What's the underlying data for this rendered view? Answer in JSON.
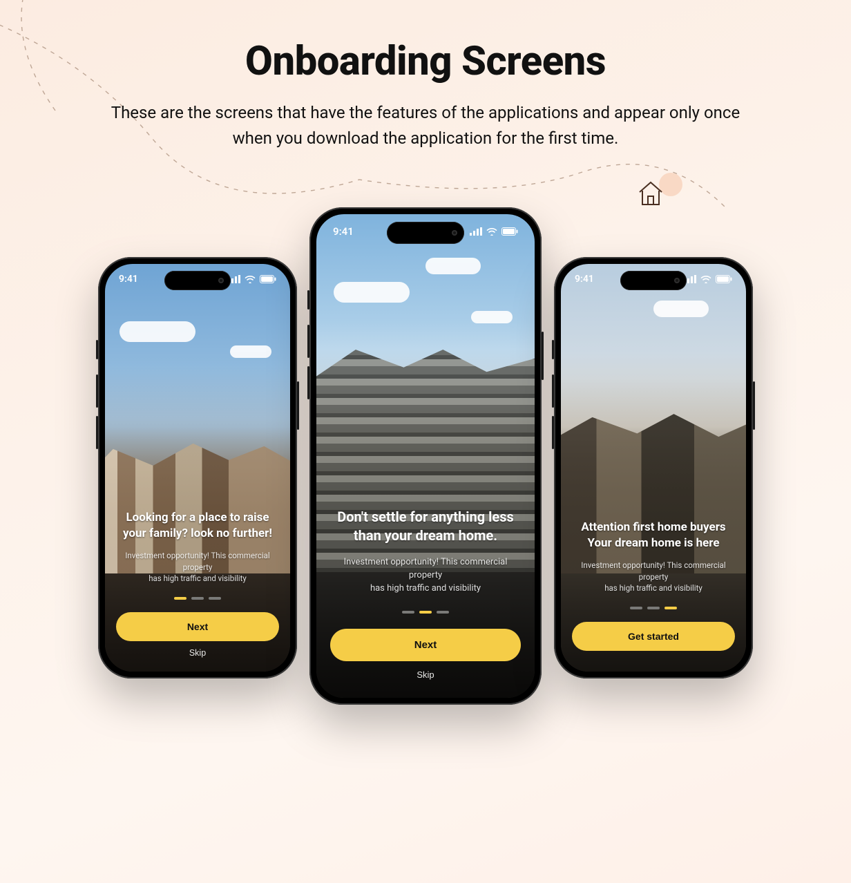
{
  "header": {
    "title": "Onboarding Screens",
    "subtitle": "These are the screens that have the features of the applications and appear only  once when you download the application for the first time."
  },
  "status_time": "9:41",
  "colors": {
    "accent": "#f5cd47",
    "ink": "#111111"
  },
  "screens": [
    {
      "heading_line1": "Looking for a place to raise",
      "heading_line2": "your family? look no further!",
      "sub_line1": "Investment opportunity! This commercial property",
      "sub_line2": "has high traffic and visibility",
      "active_dot_index": 0,
      "primary_label": "Next",
      "skip_label": "Skip"
    },
    {
      "heading_line1": "Don't settle for anything less",
      "heading_line2": "than your dream home.",
      "sub_line1": "Investment opportunity! This commercial property",
      "sub_line2": "has high traffic and visibility",
      "active_dot_index": 1,
      "primary_label": "Next",
      "skip_label": "Skip"
    },
    {
      "heading_line1": "Attention first home buyers",
      "heading_line2": "Your dream home is here",
      "sub_line1": "Investment opportunity! This commercial property",
      "sub_line2": "has high traffic and visibility",
      "active_dot_index": 2,
      "primary_label": "Get started",
      "skip_label": ""
    }
  ]
}
